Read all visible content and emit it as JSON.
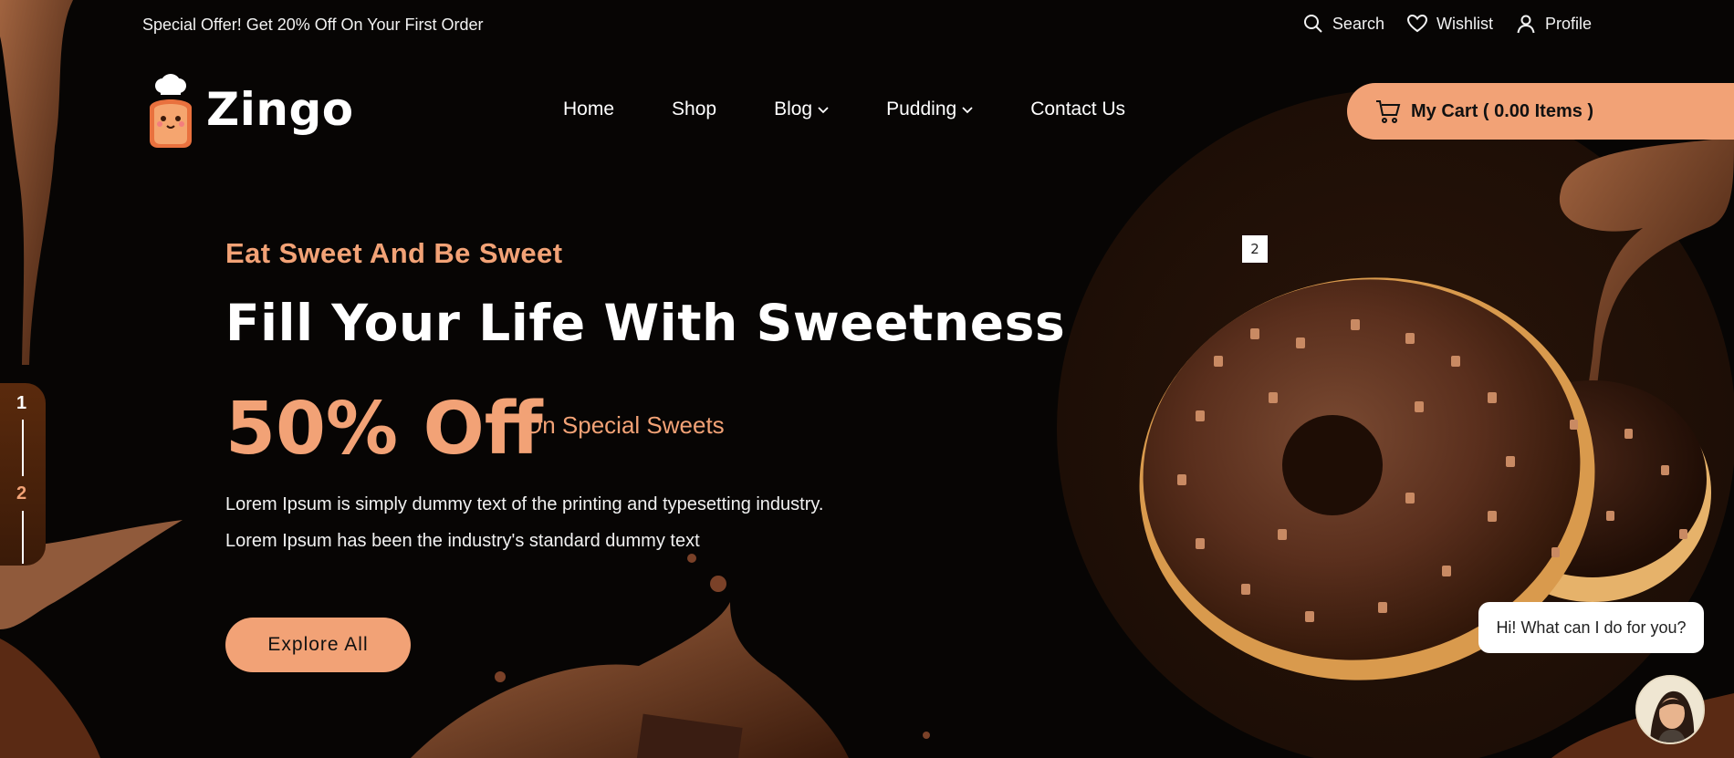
{
  "topbar": {
    "offer": "Special Offer! Get 20% Off On Your First Order",
    "links": [
      {
        "label": "Search",
        "icon": "search-icon"
      },
      {
        "label": "Wishlist",
        "icon": "heart-icon"
      },
      {
        "label": "Profile",
        "icon": "user-icon"
      }
    ]
  },
  "brand": {
    "name": "Zingo",
    "logo_icon": "chef-toast-mascot-icon"
  },
  "nav": {
    "items": [
      {
        "label": "Home",
        "dropdown": false
      },
      {
        "label": "Shop",
        "dropdown": false
      },
      {
        "label": "Blog",
        "dropdown": true
      },
      {
        "label": "Pudding",
        "dropdown": true
      },
      {
        "label": "Contact Us",
        "dropdown": false
      }
    ]
  },
  "cart": {
    "label": "My Cart ( 0.00 Items )",
    "icon": "cart-icon"
  },
  "hero": {
    "eyebrow": "Eat Sweet And Be Sweet",
    "headline": "Fill Your Life With Sweetness",
    "discount": "50% Off",
    "discount_sub": "On Special Sweets",
    "description": "Lorem Ipsum is simply dummy text of the printing and typesetting industry. Lorem Ipsum has been the industry's standard dummy text",
    "cta": "Explore All"
  },
  "slider": {
    "slides": [
      "1",
      "2"
    ],
    "badge": "2"
  },
  "chat": {
    "message": "Hi! What can I do for you?",
    "avatar_icon": "support-agent-avatar"
  },
  "colors": {
    "accent": "#f2a276",
    "background": "#070504",
    "chocolate": "#4a2414"
  }
}
